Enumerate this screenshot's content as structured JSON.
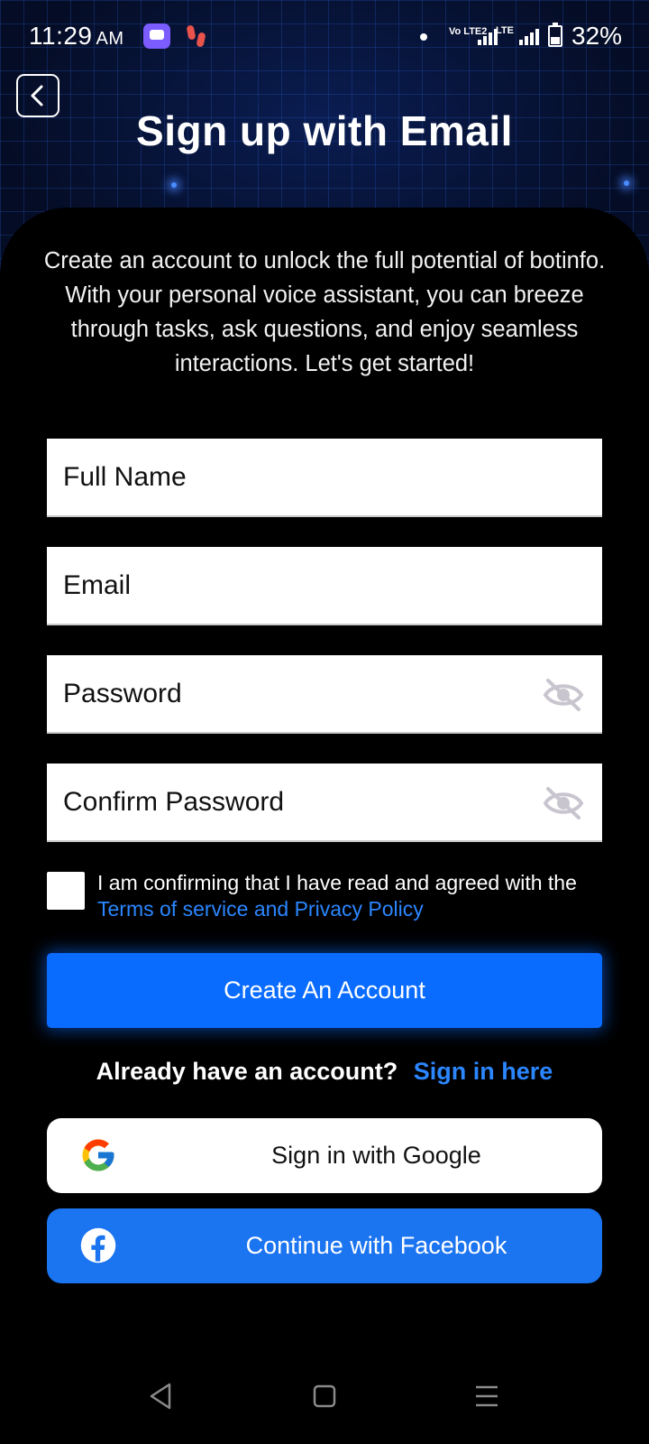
{
  "status_bar": {
    "time": "11:29",
    "ampm": "AM",
    "volte": "Vo LTE2",
    "lte": "LTE",
    "battery": "32%"
  },
  "header": {
    "title": "Sign up with Email",
    "back_icon": "chevron-left-icon"
  },
  "intro_text": "Create an account to unlock the full potential of botinfo. With your personal voice assistant, you can breeze through tasks, ask questions, and enjoy seamless interactions. Let's get started!",
  "form": {
    "full_name_placeholder": "Full Name",
    "email_placeholder": "Email",
    "password_placeholder": "Password",
    "confirm_password_placeholder": "Confirm Password",
    "visibility_icon": "eye-off-icon"
  },
  "terms": {
    "text": "I am confirming that I have read and agreed with the",
    "link": "Terms of service and Privacy Policy",
    "checked": false
  },
  "create_button_label": "Create An Account",
  "signin": {
    "prompt": "Already have an account?",
    "link": "Sign in here"
  },
  "social": {
    "google_label": "Sign in with Google",
    "facebook_label": "Continue with Facebook"
  },
  "colors": {
    "accent_blue": "#0a6cff",
    "link_blue": "#2b86ff",
    "facebook_blue": "#1b74f0",
    "background": "#000000"
  }
}
